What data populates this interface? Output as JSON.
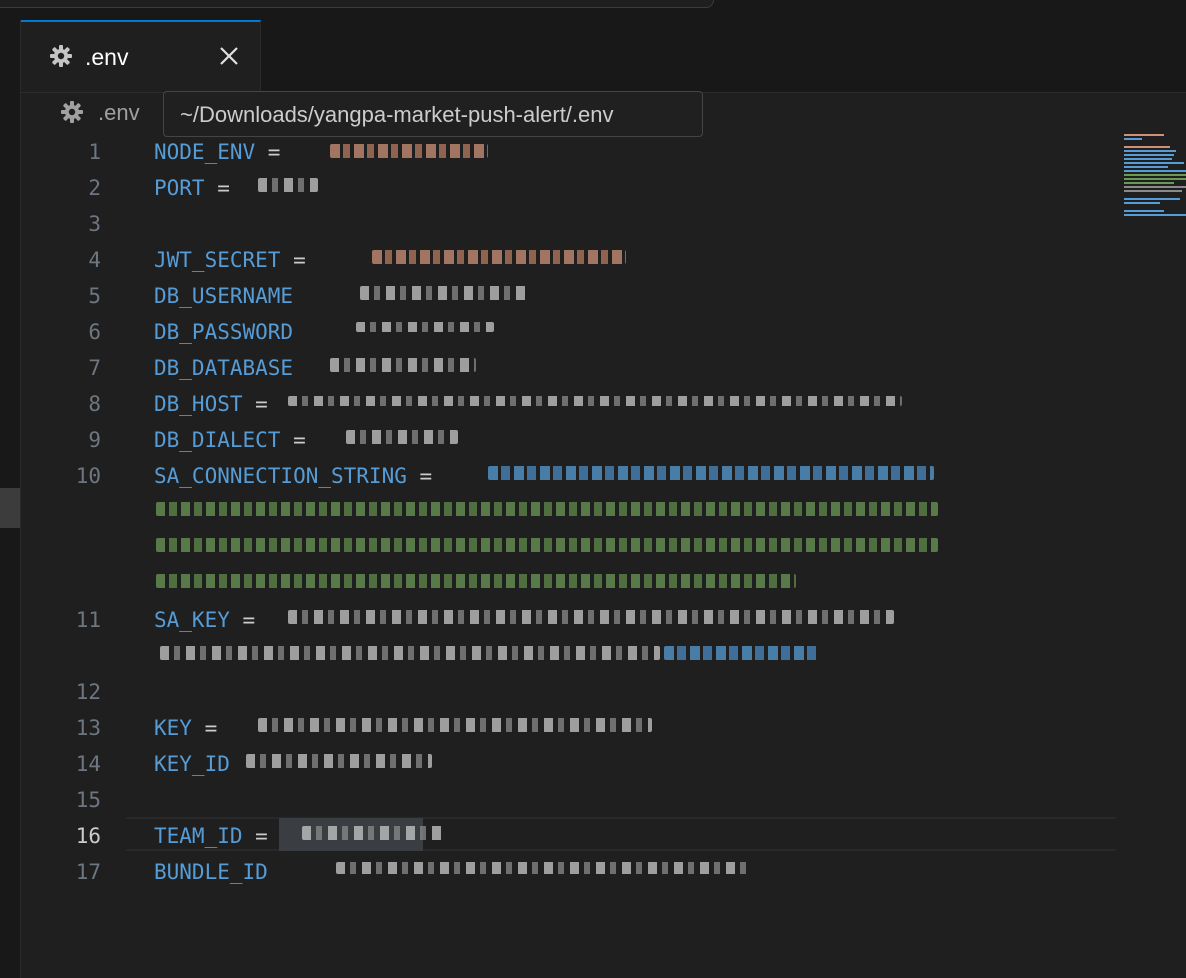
{
  "tab": {
    "filename": ".env",
    "icon": "gear-icon",
    "close_icon": "close-icon"
  },
  "breadcrumb": {
    "filename": ".env",
    "icon": "gear-icon"
  },
  "tooltip": {
    "path": "~/Downloads/yangpa-market-push-alert/.env"
  },
  "editor": {
    "active_line": 16,
    "lines": [
      {
        "number": "1",
        "key": "NODE_ENV",
        "sep": " = "
      },
      {
        "number": "2",
        "key": "PORT",
        "sep": " = "
      },
      {
        "number": "3",
        "key": "",
        "sep": ""
      },
      {
        "number": "4",
        "key": "JWT_SECRET",
        "sep": " = "
      },
      {
        "number": "5",
        "key": "DB_USERNAME",
        "sep": ""
      },
      {
        "number": "6",
        "key": "DB_PASSWORD",
        "sep": ""
      },
      {
        "number": "7",
        "key": "DB_DATABASE",
        "sep": ""
      },
      {
        "number": "8",
        "key": "DB_HOST",
        "sep": " ="
      },
      {
        "number": "9",
        "key": "DB_DIALECT",
        "sep": " ="
      },
      {
        "number": "10",
        "key": "SA_CONNECTION_STRING",
        "sep": " = "
      },
      {
        "number": "11",
        "key": "SA_KEY",
        "sep": " = "
      },
      {
        "number": "12",
        "key": "",
        "sep": ""
      },
      {
        "number": "13",
        "key": "KEY",
        "sep": " = "
      },
      {
        "number": "14",
        "key": "KEY_ID",
        "sep": ""
      },
      {
        "number": "15",
        "key": "",
        "sep": ""
      },
      {
        "number": "16",
        "key": "TEAM_ID",
        "sep": " = "
      },
      {
        "number": "17",
        "key": "BUNDLE_ID",
        "sep": ""
      }
    ]
  },
  "colors": {
    "key": "#569cd6",
    "string": "#ce9178",
    "comment": "#6a9955",
    "accent": "#0078d4"
  }
}
